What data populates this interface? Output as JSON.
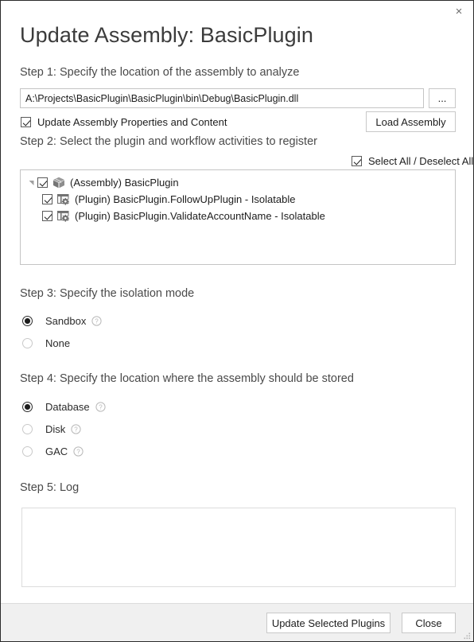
{
  "window": {
    "title": "Update Assembly: BasicPlugin",
    "close_icon": "close-icon",
    "close_glyph": "×"
  },
  "step1": {
    "label": "Step 1: Specify the location of the assembly to analyze",
    "path_value": "A:\\Projects\\BasicPlugin\\BasicPlugin\\bin\\Debug\\BasicPlugin.dll",
    "path_placeholder": "",
    "browse_label": "...",
    "update_properties_label": "Update Assembly Properties and Content",
    "update_properties_checked": true,
    "load_assembly_label": "Load Assembly"
  },
  "step2": {
    "label": "Step 2: Select the plugin and workflow activities to register",
    "select_all_label": "Select All / Deselect All",
    "select_all_checked": true,
    "tree": [
      {
        "label": "(Assembly) BasicPlugin",
        "icon": "assembly-package-icon",
        "checked": true,
        "expanded": true,
        "level": 0
      },
      {
        "label": "(Plugin) BasicPlugin.FollowUpPlugin - Isolatable",
        "icon": "plugin-gear-icon",
        "checked": true,
        "level": 1
      },
      {
        "label": "(Plugin) BasicPlugin.ValidateAccountName - Isolatable",
        "icon": "plugin-gear-icon",
        "checked": true,
        "level": 1
      }
    ]
  },
  "step3": {
    "label": "Step 3: Specify the isolation mode",
    "options": [
      {
        "label": "Sandbox",
        "selected": true,
        "help": true
      },
      {
        "label": "None",
        "selected": false,
        "help": false
      }
    ]
  },
  "step4": {
    "label": "Step 4: Specify the location where the assembly should be stored",
    "options": [
      {
        "label": "Database",
        "selected": true,
        "help": true
      },
      {
        "label": "Disk",
        "selected": false,
        "help": true
      },
      {
        "label": "GAC",
        "selected": false,
        "help": true
      }
    ]
  },
  "step5": {
    "label": "Step 5: Log",
    "log_value": "",
    "log_placeholder": ""
  },
  "footer": {
    "update_label": "Update Selected Plugins",
    "close_label": "Close"
  },
  "colors": {
    "window_border": "#2b2b2b",
    "title_text": "#3b3b3b",
    "step_text": "#4a4a4a",
    "body_text": "#1d1d1d",
    "field_border": "#c4c4c4",
    "button_border": "#c8c8c8",
    "footer_bg": "#f0f0f0",
    "help_icon": "#b8b8b8",
    "radio_off": "#c9c9c9"
  }
}
